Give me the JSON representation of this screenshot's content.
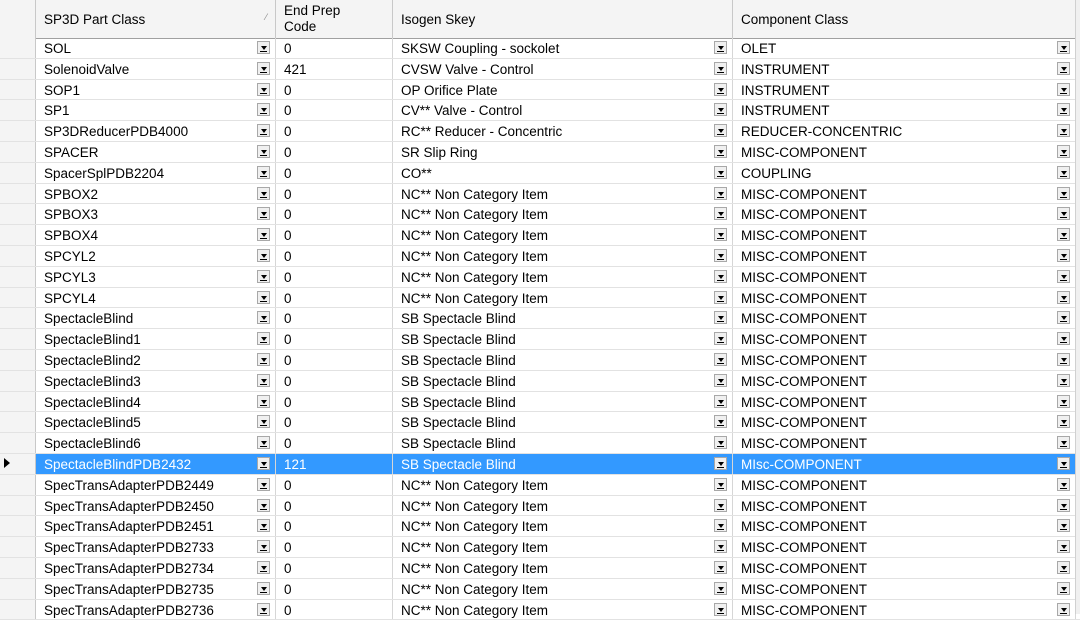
{
  "columns": {
    "part_class": "SP3D Part Class",
    "end_prep": "End Prep\nCode",
    "isogen_skey": "Isogen Skey",
    "component_class": "Component Class"
  },
  "rows": [
    {
      "part": "SOL",
      "prep": "0",
      "skey": "SKSW Coupling - sockolet",
      "comp": "OLET"
    },
    {
      "part": "SolenoidValve",
      "prep": "421",
      "skey": "CVSW Valve - Control",
      "comp": "INSTRUMENT"
    },
    {
      "part": "SOP1",
      "prep": "0",
      "skey": "OP Orifice Plate",
      "comp": "INSTRUMENT"
    },
    {
      "part": "SP1",
      "prep": "0",
      "skey": "CV** Valve - Control",
      "comp": "INSTRUMENT"
    },
    {
      "part": "SP3DReducerPDB4000",
      "prep": "0",
      "skey": "RC** Reducer - Concentric",
      "comp": "REDUCER-CONCENTRIC"
    },
    {
      "part": "SPACER",
      "prep": "0",
      "skey": "SR Slip Ring",
      "comp": "MISC-COMPONENT"
    },
    {
      "part": "SpacerSplPDB2204",
      "prep": "0",
      "skey": "CO**",
      "comp": "COUPLING"
    },
    {
      "part": "SPBOX2",
      "prep": "0",
      "skey": "NC** Non Category Item",
      "comp": "MISC-COMPONENT"
    },
    {
      "part": "SPBOX3",
      "prep": "0",
      "skey": "NC** Non Category Item",
      "comp": "MISC-COMPONENT"
    },
    {
      "part": "SPBOX4",
      "prep": "0",
      "skey": "NC** Non Category Item",
      "comp": "MISC-COMPONENT"
    },
    {
      "part": "SPCYL2",
      "prep": "0",
      "skey": "NC** Non Category Item",
      "comp": "MISC-COMPONENT"
    },
    {
      "part": "SPCYL3",
      "prep": "0",
      "skey": "NC** Non Category Item",
      "comp": "MISC-COMPONENT"
    },
    {
      "part": "SPCYL4",
      "prep": "0",
      "skey": "NC** Non Category Item",
      "comp": "MISC-COMPONENT"
    },
    {
      "part": "SpectacleBlind",
      "prep": "0",
      "skey": "SB Spectacle Blind",
      "comp": "MISC-COMPONENT"
    },
    {
      "part": "SpectacleBlind1",
      "prep": "0",
      "skey": "SB Spectacle Blind",
      "comp": "MISC-COMPONENT"
    },
    {
      "part": "SpectacleBlind2",
      "prep": "0",
      "skey": "SB Spectacle Blind",
      "comp": "MISC-COMPONENT"
    },
    {
      "part": "SpectacleBlind3",
      "prep": "0",
      "skey": "SB Spectacle Blind",
      "comp": "MISC-COMPONENT"
    },
    {
      "part": "SpectacleBlind4",
      "prep": "0",
      "skey": "SB Spectacle Blind",
      "comp": "MISC-COMPONENT"
    },
    {
      "part": "SpectacleBlind5",
      "prep": "0",
      "skey": "SB Spectacle Blind",
      "comp": "MISC-COMPONENT"
    },
    {
      "part": "SpectacleBlind6",
      "prep": "0",
      "skey": "SB Spectacle Blind",
      "comp": "MISC-COMPONENT"
    },
    {
      "part": "SpectacleBlindPDB2432",
      "prep": "121",
      "skey": "SB Spectacle Blind",
      "comp": "MIsc-COMPONENT",
      "selected": true
    },
    {
      "part": "SpecTransAdapterPDB2449",
      "prep": "0",
      "skey": "NC** Non Category Item",
      "comp": "MISC-COMPONENT"
    },
    {
      "part": "SpecTransAdapterPDB2450",
      "prep": "0",
      "skey": "NC** Non Category Item",
      "comp": "MISC-COMPONENT"
    },
    {
      "part": "SpecTransAdapterPDB2451",
      "prep": "0",
      "skey": "NC** Non Category Item",
      "comp": "MISC-COMPONENT"
    },
    {
      "part": "SpecTransAdapterPDB2733",
      "prep": "0",
      "skey": "NC** Non Category Item",
      "comp": "MISC-COMPONENT"
    },
    {
      "part": "SpecTransAdapterPDB2734",
      "prep": "0",
      "skey": "NC** Non Category Item",
      "comp": "MISC-COMPONENT"
    },
    {
      "part": "SpecTransAdapterPDB2735",
      "prep": "0",
      "skey": "NC** Non Category Item",
      "comp": "MISC-COMPONENT"
    },
    {
      "part": "SpecTransAdapterPDB2736",
      "prep": "0",
      "skey": "NC** Non Category Item",
      "comp": "MISC-COMPONENT"
    }
  ]
}
